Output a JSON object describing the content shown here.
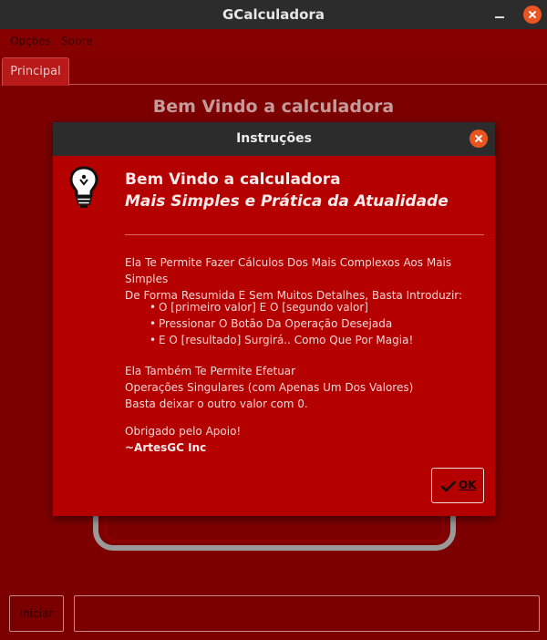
{
  "window": {
    "title": "GCalculadora"
  },
  "menu": {
    "items": [
      "Opções",
      "Sobre"
    ]
  },
  "tabs": [
    "Principal"
  ],
  "main": {
    "heading": "Bem Vindo a calculadora",
    "start_button": "Iniciar"
  },
  "dialog": {
    "title": "Instruções",
    "icon": "lightbulb-icon",
    "heading1": "Bem Vindo a calculadora",
    "heading2": "Mais Simples e Prática da Atualidade",
    "paragraph1": [
      "Ela Te Permite Fazer Cálculos Dos Mais Complexos Aos Mais Simples",
      "De Forma Resumida E Sem Muitos Detalhes, Basta Introduzir:"
    ],
    "bullets": [
      "O [primeiro valor] E O [segundo valor]",
      "Pressionar O Botão Da Operação Desejada",
      "E O [resultado] Surgirá.. Como Que Por Magia!"
    ],
    "paragraph2": [
      "Ela Também Te Permite Efetuar",
      "Operações Singulares (com Apenas Um Dos Valores)",
      "Basta deixar o outro valor com 0."
    ],
    "thanks": "Obrigado pelo Apoio!",
    "signature": "~ArtesGC Inc",
    "ok_label": "OK"
  },
  "colors": {
    "background": "#7d0000",
    "dialog": "#b50000",
    "titlebar": "#2c2c2c",
    "close": "#e95420"
  }
}
